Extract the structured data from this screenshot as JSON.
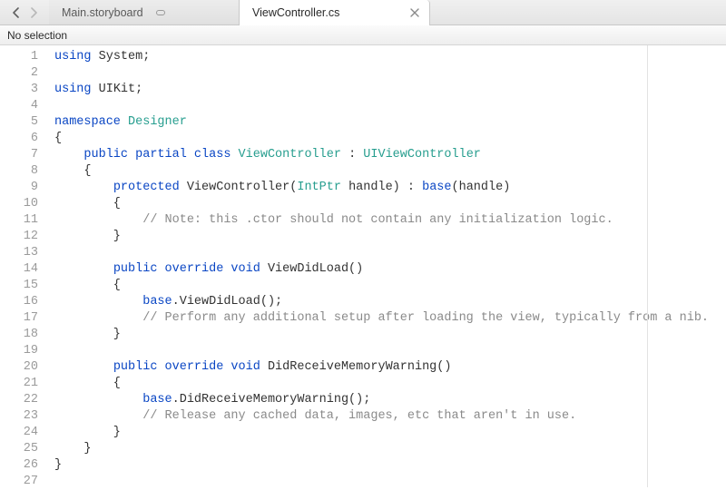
{
  "nav": {
    "back_enabled": true,
    "forward_enabled": false
  },
  "tabs": [
    {
      "label": "Main.storyboard",
      "active": false,
      "closable": false
    },
    {
      "label": "ViewController.cs",
      "active": true,
      "closable": true
    }
  ],
  "selection_bar": {
    "text": "No selection"
  },
  "code": {
    "lines": [
      [
        {
          "t": "using",
          "c": "kw"
        },
        {
          "t": " System;",
          "c": ""
        }
      ],
      [],
      [
        {
          "t": "using",
          "c": "kw"
        },
        {
          "t": " UIKit;",
          "c": ""
        }
      ],
      [],
      [
        {
          "t": "namespace",
          "c": "kw"
        },
        {
          "t": " ",
          "c": ""
        },
        {
          "t": "Designer",
          "c": "type"
        }
      ],
      [
        {
          "t": "{",
          "c": ""
        }
      ],
      [
        {
          "t": "    ",
          "c": ""
        },
        {
          "t": "public partial class",
          "c": "kw"
        },
        {
          "t": " ",
          "c": ""
        },
        {
          "t": "ViewController",
          "c": "type"
        },
        {
          "t": " : ",
          "c": ""
        },
        {
          "t": "UIViewController",
          "c": "type"
        }
      ],
      [
        {
          "t": "    {",
          "c": ""
        }
      ],
      [
        {
          "t": "        ",
          "c": ""
        },
        {
          "t": "protected",
          "c": "kw"
        },
        {
          "t": " ViewController(",
          "c": ""
        },
        {
          "t": "IntPtr",
          "c": "type"
        },
        {
          "t": " handle) : ",
          "c": ""
        },
        {
          "t": "base",
          "c": "kw"
        },
        {
          "t": "(handle)",
          "c": ""
        }
      ],
      [
        {
          "t": "        {",
          "c": ""
        }
      ],
      [
        {
          "t": "            ",
          "c": ""
        },
        {
          "t": "// Note: this .ctor should not contain any initialization logic.",
          "c": "cmt"
        }
      ],
      [
        {
          "t": "        }",
          "c": ""
        }
      ],
      [],
      [
        {
          "t": "        ",
          "c": ""
        },
        {
          "t": "public override void",
          "c": "kw"
        },
        {
          "t": " ViewDidLoad()",
          "c": ""
        }
      ],
      [
        {
          "t": "        {",
          "c": ""
        }
      ],
      [
        {
          "t": "            ",
          "c": ""
        },
        {
          "t": "base",
          "c": "kw"
        },
        {
          "t": ".ViewDidLoad();",
          "c": ""
        }
      ],
      [
        {
          "t": "            ",
          "c": ""
        },
        {
          "t": "// Perform any additional setup after loading the view, typically from a nib.",
          "c": "cmt"
        }
      ],
      [
        {
          "t": "        }",
          "c": ""
        }
      ],
      [],
      [
        {
          "t": "        ",
          "c": ""
        },
        {
          "t": "public override void",
          "c": "kw"
        },
        {
          "t": " DidReceiveMemoryWarning()",
          "c": ""
        }
      ],
      [
        {
          "t": "        {",
          "c": ""
        }
      ],
      [
        {
          "t": "            ",
          "c": ""
        },
        {
          "t": "base",
          "c": "kw"
        },
        {
          "t": ".DidReceiveMemoryWarning();",
          "c": ""
        }
      ],
      [
        {
          "t": "            ",
          "c": ""
        },
        {
          "t": "// Release any cached data, images, etc that aren't in use.",
          "c": "cmt"
        }
      ],
      [
        {
          "t": "        }",
          "c": ""
        }
      ],
      [
        {
          "t": "    }",
          "c": ""
        }
      ],
      [
        {
          "t": "}",
          "c": ""
        }
      ],
      []
    ]
  }
}
